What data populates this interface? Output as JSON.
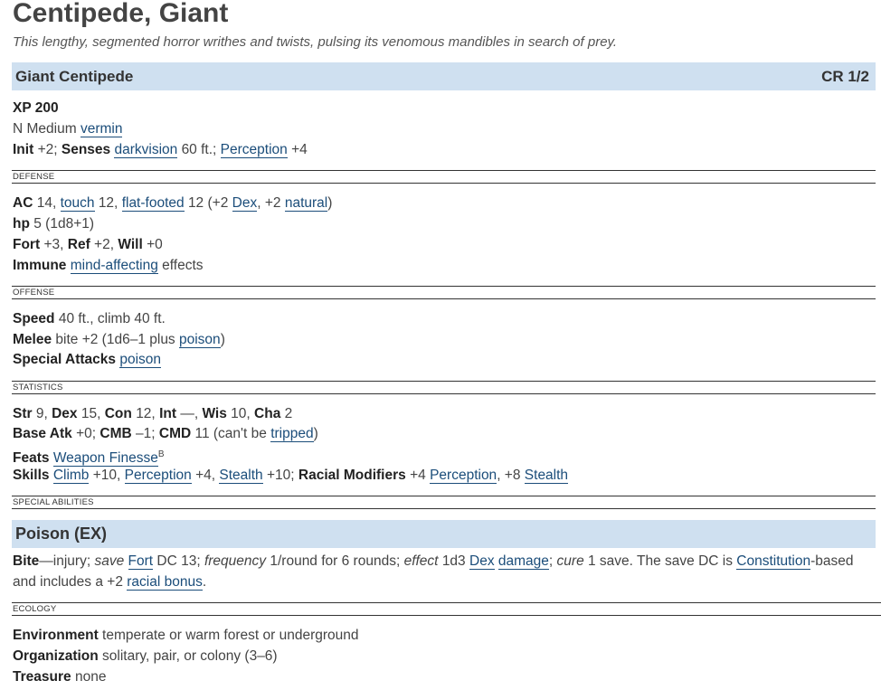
{
  "header": {
    "title": "Centipede, Giant",
    "description": "This lengthy, segmented horror writhes and twists, pulsing its venomous mandibles in search of prey."
  },
  "statblock": {
    "name": "Giant Centipede",
    "cr": "CR 1/2",
    "xp": "XP 200",
    "alignment_size": "N Medium",
    "type_link": "vermin",
    "init_label": "Init",
    "init_value": "+2;",
    "senses_label": "Senses",
    "senses_link": "darkvision",
    "senses_rest": "60 ft.;",
    "perception_link": "Perception",
    "perception_value": "+4"
  },
  "defense": {
    "section_label": "DEFENSE",
    "ac_label": "AC",
    "ac_value": "14,",
    "touch_link": "touch",
    "touch_value": "12,",
    "ff_link": "flat-footed",
    "ff_value": "12 (+2",
    "dex_link": "Dex",
    "natural_pre": ", +2",
    "natural_link": "natural",
    "close_paren": ")",
    "hp_label": "hp",
    "hp_value": "5 (1d8+1)",
    "fort_label": "Fort",
    "fort_value": "+3,",
    "ref_label": "Ref",
    "ref_value": "+2,",
    "will_label": "Will",
    "will_value": "+0",
    "immune_label": "Immune",
    "immune_link": "mind-affecting",
    "immune_rest": "effects"
  },
  "offense": {
    "section_label": "OFFENSE",
    "speed_label": "Speed",
    "speed_value": "40 ft., climb 40 ft.",
    "melee_label": "Melee",
    "melee_value": "bite +2 (1d6–1 plus",
    "melee_link": "poison",
    "close_paren": ")",
    "sa_label": "Special Attacks",
    "sa_link": "poison"
  },
  "statistics": {
    "section_label": "STATISTICS",
    "str_label": "Str",
    "str_value": "9,",
    "dex_label": "Dex",
    "dex_value": "15,",
    "con_label": "Con",
    "con_value": "12,",
    "int_label": "Int",
    "int_value": "—,",
    "wis_label": "Wis",
    "wis_value": "10,",
    "cha_label": "Cha",
    "cha_value": "2",
    "bab_label": "Base Atk",
    "bab_value": "+0;",
    "cmb_label": "CMB",
    "cmb_value": "–1;",
    "cmd_label": "CMD",
    "cmd_value": "11 (can't be",
    "cmd_link": "tripped",
    "close_paren": ")",
    "feats_label": "Feats",
    "feats_link": "Weapon Finesse",
    "feats_sup": "B",
    "skills_label": "Skills",
    "climb_link": "Climb",
    "climb_value": "+10,",
    "skill_perception_link": "Perception",
    "skill_perception_value": "+4,",
    "stealth_link": "Stealth",
    "stealth_value": "+10;",
    "racial_label": "Racial Modifiers",
    "racial_pre": "+4",
    "racial_perception_link": "Perception",
    "racial_mid": ", +8",
    "racial_stealth_link": "Stealth"
  },
  "special_abilities": {
    "section_label": "SPECIAL ABILITIES",
    "ability_name": "Poison (EX)",
    "bite_label": "Bite",
    "t1": "—injury;",
    "save_i": "save",
    "fort_link": "Fort",
    "t2": "DC 13;",
    "freq_i": "frequency",
    "t3": "1/round for 6 rounds;",
    "effect_i": "effect",
    "t4": "1d3",
    "dex_link": "Dex",
    "damage_link": "damage",
    "t5": ";",
    "cure_i": "cure",
    "t6": "1 save. The save DC is",
    "con_link": "Constitution",
    "t7": "-based and includes a +2",
    "racial_link": "racial bonus",
    "t8": "."
  },
  "ecology": {
    "section_label": "ECOLOGY",
    "env_label": "Environment",
    "env_value": "temperate or warm forest or underground",
    "org_label": "Organization",
    "org_value": "solitary, pair, or colony (3–6)",
    "treasure_label": "Treasure",
    "treasure_value": "none"
  },
  "colors": {
    "band": "#cfe0f0",
    "link": "#1b4d7a",
    "title": "#444444"
  }
}
